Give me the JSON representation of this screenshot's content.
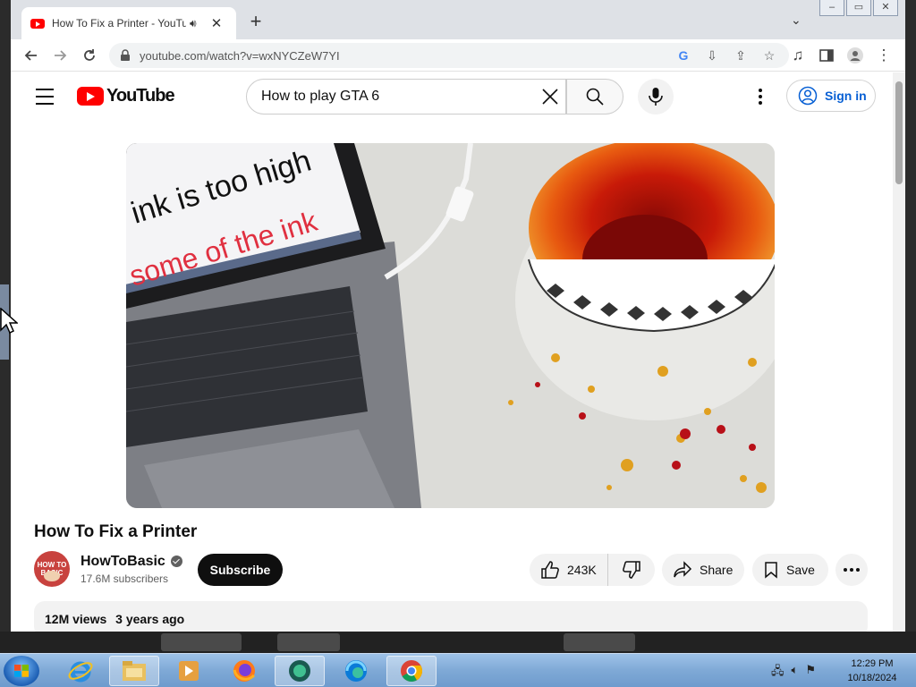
{
  "browser": {
    "tab": {
      "title": "How To Fix a Printer - YouTube"
    },
    "address": {
      "url": "youtube.com/watch?v=wxNYCZeW7YI"
    }
  },
  "youtube": {
    "header": {
      "logo_text": "YouTube",
      "search": {
        "query": "How to play GTA 6"
      },
      "sign_in_label": "Sign in"
    },
    "player": {
      "overlay_line1": "ink is too high",
      "overlay_line2": "some of the ink"
    },
    "video": {
      "title": "How To Fix a Printer",
      "channel": {
        "name": "HowToBasic",
        "avatar_text": "HOW TO BASIC",
        "subscribers": "17.6M subscribers",
        "verified": true
      },
      "subscribe_label": "Subscribe",
      "likes": "243K",
      "share_label": "Share",
      "save_label": "Save",
      "views": "12M views",
      "age": "3 years ago"
    }
  },
  "taskbar": {
    "clock_time": "12:29 PM",
    "clock_date": "10/18/2024"
  },
  "colors": {
    "youtube_red": "#ff0000",
    "link_blue": "#065fd4",
    "subscribe_bg": "#0f0f0f",
    "pill_bg": "#f2f2f2"
  }
}
